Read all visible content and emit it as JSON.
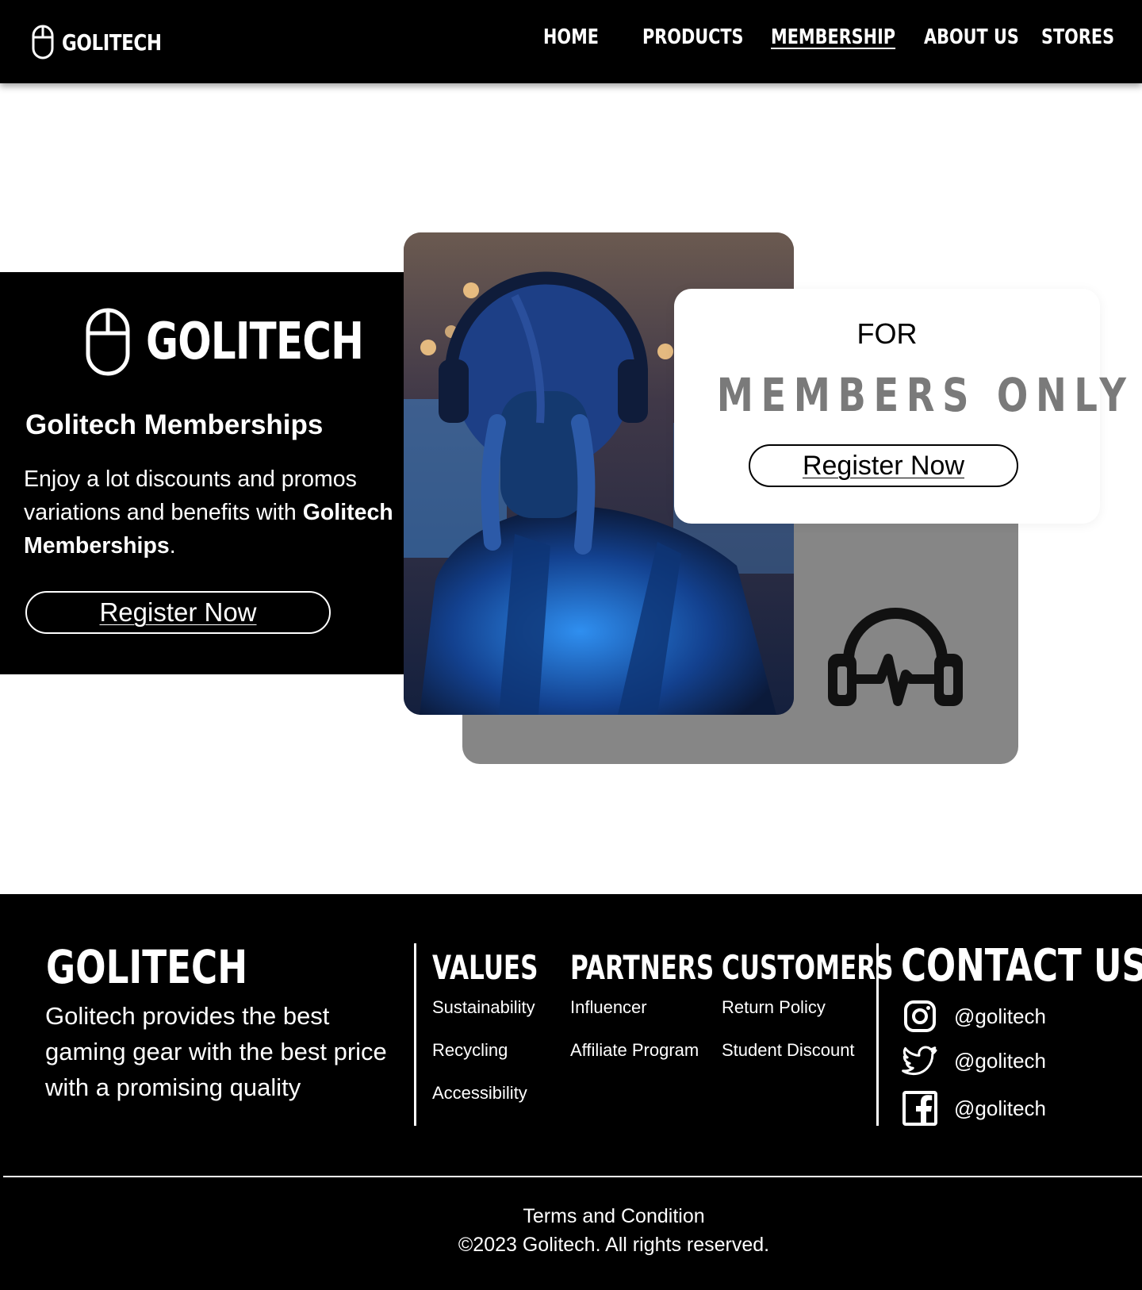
{
  "nav": {
    "brand": "GOLITECH",
    "links": [
      "HOME",
      "PRODUCTS",
      "MEMBERSHIP",
      "ABOUT US",
      "STORES"
    ],
    "active": "MEMBERSHIP"
  },
  "hero": {
    "brand": "GOLITECH",
    "title": "Golitech Memberships",
    "description_prefix": "Enjoy a lot discounts and promos variations and benefits with ",
    "description_bold": "Golitech Memberships",
    "description_suffix": ".",
    "button": "Register Now"
  },
  "photo": {
    "subject": "gamer-with-headphones-photo"
  },
  "members_card": {
    "for": "FOR",
    "title": "MEMBERS ONLY",
    "button": "Register Now"
  },
  "footer": {
    "brand": "GOLITECH",
    "description": "Golitech provides the best gaming gear with the best price with a promising quality",
    "columns": [
      {
        "heading": "VALUES",
        "links": [
          "Sustainability",
          "Recycling",
          "Accessibility"
        ]
      },
      {
        "heading": "PARTNERS",
        "links": [
          "Influencer",
          "Affiliate Program"
        ]
      },
      {
        "heading": "CUSTOMERS",
        "links": [
          "Return Policy",
          "Student Discount"
        ]
      }
    ],
    "contact": {
      "heading": "CONTACT US",
      "socials": [
        {
          "icon": "instagram-icon",
          "handle": "@golitech"
        },
        {
          "icon": "twitter-icon",
          "handle": "@golitech"
        },
        {
          "icon": "facebook-icon",
          "handle": "@golitech"
        }
      ]
    },
    "terms": "Terms and Condition",
    "copyright": "©2023 Golitech. All rights reserved."
  },
  "colors": {
    "primary": "#000000",
    "background": "#ffffff",
    "muted_block": "#868686",
    "members_only_text": "#7a7a7a"
  }
}
